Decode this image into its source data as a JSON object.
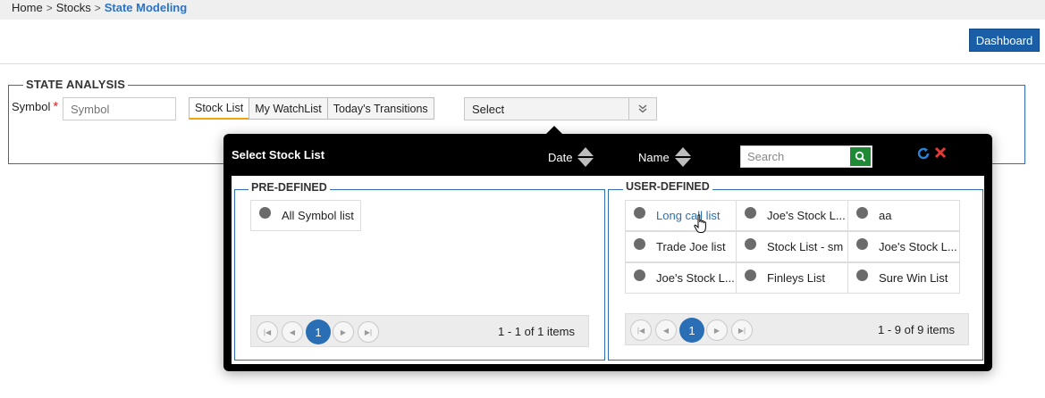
{
  "breadcrumb": {
    "items": [
      "Home",
      "Stocks"
    ],
    "current": "State Modeling",
    "separator": ">"
  },
  "header": {
    "dashboard_label": "Dashboard"
  },
  "state_analysis": {
    "legend": "STATE ANALYSIS",
    "symbol_label": "Symbol",
    "required_mark": "*",
    "symbol_placeholder": "Symbol",
    "tabs": [
      "Stock List",
      "My WatchList",
      "Today's Transitions"
    ],
    "active_tab": "Stock List",
    "select_value": "Select"
  },
  "popup": {
    "title": "Select Stock List",
    "sort_date": "Date",
    "sort_name": "Name",
    "search_placeholder": "Search",
    "predefined": {
      "legend": "PRE-DEFINED",
      "items": [
        "All Symbol list"
      ],
      "page": "1",
      "info": "1 - 1 of 1 items"
    },
    "userdefined": {
      "legend": "USER-DEFINED",
      "items": [
        "Long call list",
        "Joe's Stock L...",
        "aa",
        "Trade Joe list",
        "Stock List - sm",
        "Joe's Stock L...",
        "Joe's Stock L...",
        "Finleys List",
        "Sure Win List"
      ],
      "hovered_item": "Long call list",
      "page": "1",
      "info": "1 - 9 of 9 items"
    }
  },
  "colors": {
    "accent": "#1a5ea8",
    "link": "#2a6fb5",
    "tab_underline": "#f0a40a",
    "close": "#e53935",
    "search_button": "#1e8a35"
  }
}
